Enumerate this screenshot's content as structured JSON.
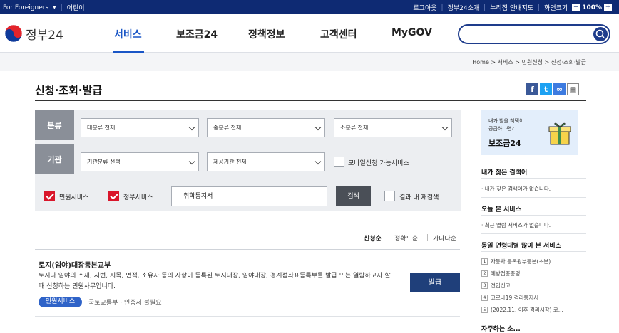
{
  "topbar": {
    "foreigners": "For Foreigners",
    "kids": "어린이",
    "logout": "로그아웃",
    "intro": "정부24소개",
    "guide": "누리집 안내지도",
    "screen_size": "화면크기",
    "zoom": "100%",
    "zoom_minus": "−",
    "zoom_plus": "+"
  },
  "header": {
    "logo": "정부24",
    "nav": [
      "서비스",
      "보조금24",
      "정책정보",
      "고객센터",
      "MyGOV"
    ],
    "search_placeholder": ""
  },
  "breadcrumb": "Home  >  서비스  >  민원신청  >  신청·조회·발급",
  "page_title": "신청·조회·발급",
  "filter": {
    "label_category": "분류",
    "label_agency": "기관",
    "select_major": "대분류 전체",
    "select_middle": "중분류 전체",
    "select_minor": "소분류 전체",
    "select_agency_type": "기관분류 선택",
    "select_provider": "제공기관 전체",
    "mobile_only": "모바일신청 가능서비스",
    "civil_service": "민원서비스",
    "gov_service": "정부서비스",
    "keyword": "취학통지서",
    "search_button": "검색",
    "research": "결과 내 재검색"
  },
  "sort": [
    "신청순",
    "정확도순",
    "가나다순"
  ],
  "result": {
    "title": "토지(임야)대장등본교부",
    "desc": "토지나 임야의 소재, 지번, 지목, 면적, 소유자 등의 사항이 등록된 토지대장, 임야대장, 경계점좌표등록부를 발급 또는 열람하고자 할 때 신청하는 민원사무입니다.",
    "badge": "민원서비스",
    "meta": "국토교통부  ·  인증서 불필요",
    "issue_button": "발급"
  },
  "sidebar": {
    "banner_line1": "내가 받을 혜택이",
    "banner_line2": "궁금하다면?",
    "banner_title": "보조금24",
    "my_search_title": "내가 찾은 검색어",
    "my_search_empty": "· 내가 찾은 검색어가 없습니다.",
    "today_title": "오늘 본 서비스",
    "today_empty": "· 최근 열람 서비스가 없습니다.",
    "popular_title": "동일 연령대별 많이 본 서비스",
    "popular": [
      "자동차 등록원부등본(초본) ...",
      "예방접종증명",
      "전입신고",
      "코로나19 격리통지서",
      "(2022.11. 이후 격리시작) 코..."
    ],
    "more_title": "자주하는 소..."
  },
  "colors": {
    "topbar": "#0e2a73",
    "accent": "#1a56c6",
    "check_red": "#d9162b",
    "issue_button": "#1f3f7a"
  }
}
